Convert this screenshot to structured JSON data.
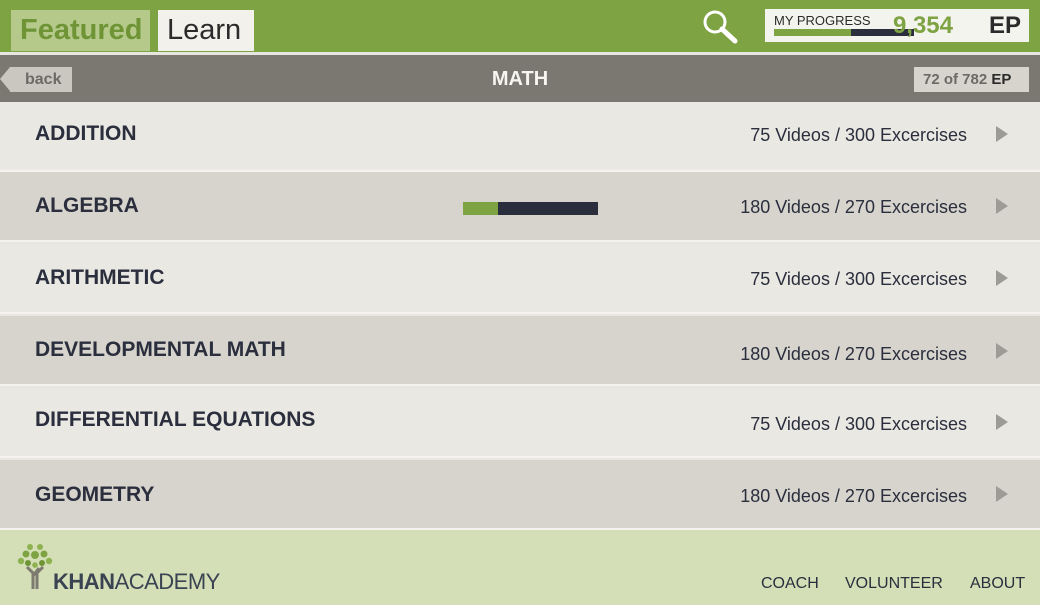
{
  "header": {
    "tabs": [
      {
        "label": "Featured",
        "active": false
      },
      {
        "label": "Learn",
        "active": true
      }
    ],
    "search_icon": "search-icon",
    "progress": {
      "label": "MY PROGRESS",
      "value": "9,354",
      "unit": "EP",
      "fraction": 0.55
    }
  },
  "subheader": {
    "back_label": "back",
    "title": "MATH",
    "count": {
      "text": "72 of 782",
      "unit": "EP"
    }
  },
  "topics": [
    {
      "title": "ADDITION",
      "meta": "75 Videos / 300 Excercises",
      "progress": null
    },
    {
      "title": "ALGEBRA",
      "meta": "180 Videos / 270 Excercises",
      "progress": 0.26
    },
    {
      "title": "ARITHMETIC",
      "meta": "75 Videos / 300 Excercises",
      "progress": null
    },
    {
      "title": "DEVELOPMENTAL MATH",
      "meta": "180 Videos / 270 Excercises",
      "progress": null
    },
    {
      "title": "DIFFERENTIAL EQUATIONS",
      "meta": "75 Videos / 300 Excercises",
      "progress": null
    },
    {
      "title": "GEOMETRY",
      "meta": "180 Videos / 270 Excercises",
      "progress": null
    }
  ],
  "footer": {
    "logo": {
      "part1": "KHAN",
      "part2": "ACADEMY"
    },
    "links": [
      "COACH",
      "VOLUNTEER",
      "ABOUT"
    ]
  },
  "colors": {
    "brand_green": "#7ea342",
    "navy": "#2a2e3d"
  }
}
